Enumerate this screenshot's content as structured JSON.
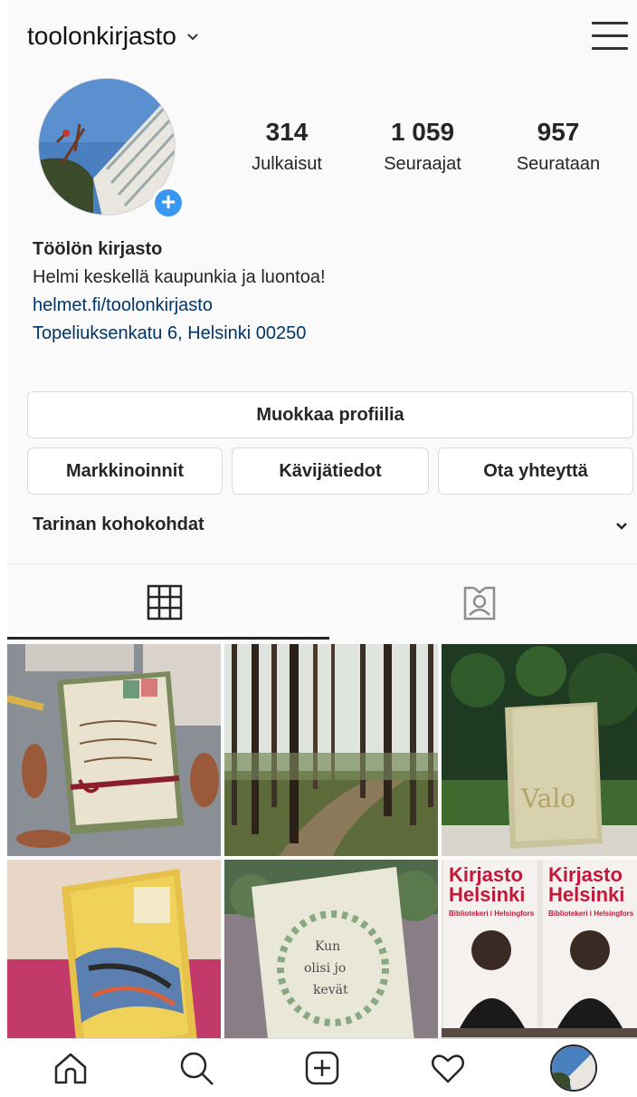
{
  "header": {
    "username": "toolonkirjasto",
    "menu_icon": "hamburger-menu-icon",
    "dropdown_icon": "chevron-down-icon"
  },
  "profile": {
    "stats": [
      {
        "value": "314",
        "label": "Julkaisut"
      },
      {
        "value": "1 059",
        "label": "Seuraajat"
      },
      {
        "value": "957",
        "label": "Seurataan"
      }
    ],
    "name": "Töölön kirjasto",
    "bio": "Helmi keskellä kaupunkia ja luontoa!",
    "website": "helmet.fi/toolonkirjasto",
    "address": "Topeliuksenkatu 6, Helsinki 00250"
  },
  "buttons": {
    "edit_profile": "Muokkaa profiilia",
    "promotions": "Markkinoinnit",
    "insights": "Kävijätiedot",
    "contact": "Ota yhteyttä"
  },
  "highlights": {
    "label": "Tarinan kohokohdat"
  },
  "tabs": [
    {
      "icon": "grid-icon",
      "active": true
    },
    {
      "icon": "tagged-person-icon",
      "active": false
    }
  ],
  "posts": {
    "post5_text": [
      "Kun",
      "olisi jo",
      "kevät"
    ],
    "post6_title": [
      "Kirjasto",
      "Helsinki"
    ],
    "post6_subtitle": "Bibliotekeri i Helsingfors"
  },
  "colors": {
    "link": "#003569",
    "accent_blue": "#3897f0",
    "text": "#262626",
    "border": "#dbdbdb"
  },
  "bottom_nav": [
    {
      "icon": "home-icon"
    },
    {
      "icon": "search-icon"
    },
    {
      "icon": "new-post-icon"
    },
    {
      "icon": "heart-icon"
    },
    {
      "icon": "profile-avatar-icon"
    }
  ]
}
